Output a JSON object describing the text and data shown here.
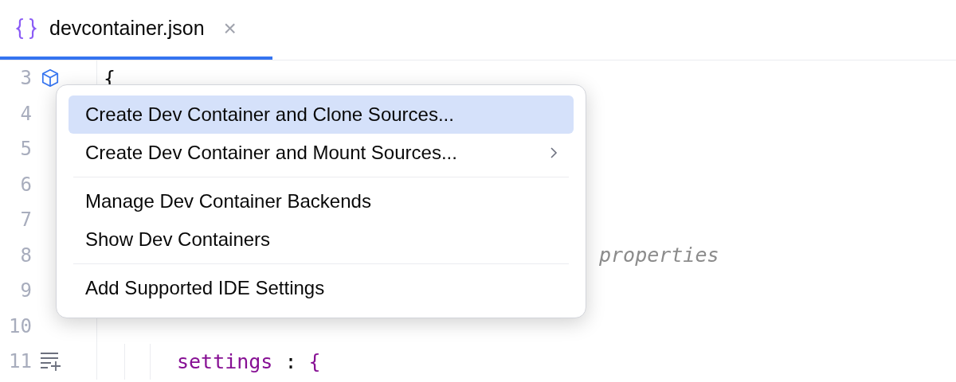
{
  "tab": {
    "title": "devcontainer.json",
    "close": "×",
    "selected": true
  },
  "lines": [
    {
      "number": "3",
      "kind": "container",
      "segments": [
        {
          "kind": "brace",
          "text": "{"
        }
      ]
    },
    {
      "number": "4",
      "kind": "plain"
    },
    {
      "number": "5",
      "kind": "plain"
    },
    {
      "number": "6",
      "kind": "plain"
    },
    {
      "number": "7",
      "kind": "plain"
    },
    {
      "number": "8",
      "kind": "plain",
      "segments": [
        {
          "kind": "comment",
          "text": "properties"
        }
      ]
    },
    {
      "number": "9",
      "kind": "plain"
    },
    {
      "number": "10",
      "kind": "plain"
    },
    {
      "number": "11",
      "kind": "add-list",
      "segments": [
        {
          "kind": "key",
          "text": "settings"
        },
        {
          "kind": "punct",
          "text": " : "
        },
        {
          "kind": "brace-key",
          "text": "{"
        }
      ]
    }
  ],
  "menu": {
    "groups": [
      [
        {
          "label": "Create Dev Container and Clone Sources...",
          "selected": true,
          "submenu": false
        },
        {
          "label": "Create Dev Container and Mount Sources...",
          "selected": false,
          "submenu": true
        }
      ],
      [
        {
          "label": "Manage Dev Container Backends",
          "selected": false,
          "submenu": false
        },
        {
          "label": "Show Dev Containers",
          "selected": false,
          "submenu": false
        }
      ],
      [
        {
          "label": "Add Supported IDE Settings",
          "selected": false,
          "submenu": false
        }
      ]
    ]
  }
}
